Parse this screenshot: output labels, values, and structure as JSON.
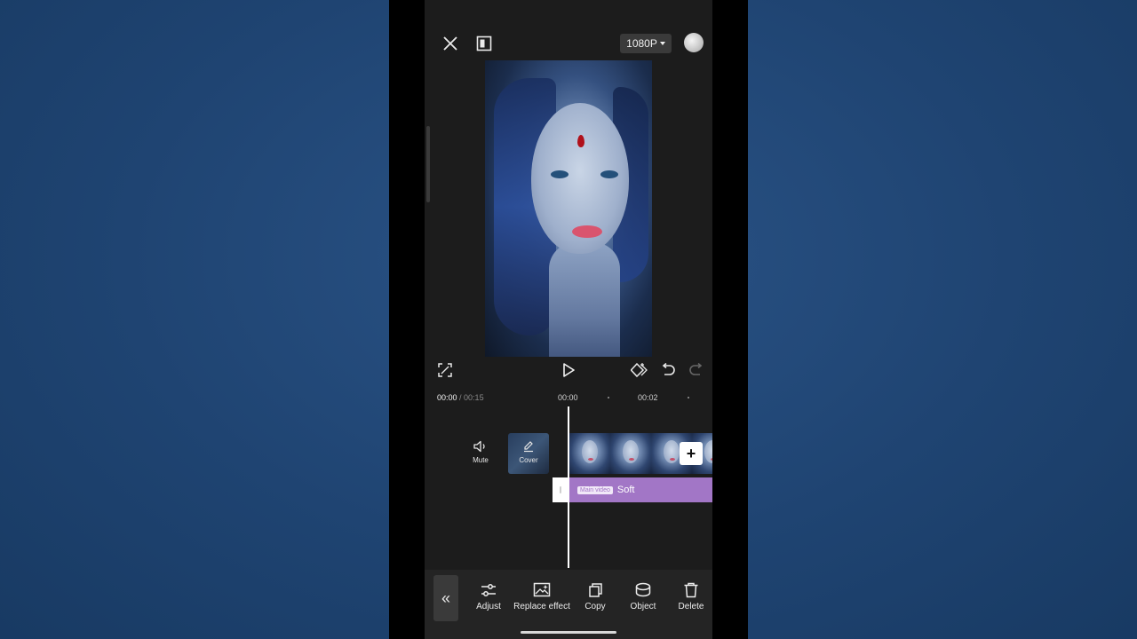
{
  "topbar": {
    "close_icon": "close-icon",
    "layout_icon": "layout-icon",
    "resolution": "1080P",
    "export_icon": "export-icon"
  },
  "preview": {
    "description_icon": "video-preview"
  },
  "controls": {
    "fullscreen_icon": "fullscreen-icon",
    "play_icon": "play-icon",
    "keyframe_icon": "keyframe-icon",
    "undo_icon": "undo-icon",
    "redo_icon": "redo-icon"
  },
  "timeline": {
    "current_time": "00:00",
    "total_time": "/ 00:15",
    "ruler": [
      "00:00",
      "00:02"
    ]
  },
  "track": {
    "mute_label": "Mute",
    "cover_label": "Cover",
    "add_icon": "plus-icon"
  },
  "effect": {
    "badge": "Main video",
    "name": "Soft",
    "color": "#a276c6"
  },
  "toolbar": {
    "items": [
      {
        "label": "Adjust",
        "icon": "adjust-icon"
      },
      {
        "label": "Replace effect",
        "icon": "replace-effect-icon"
      },
      {
        "label": "Copy",
        "icon": "copy-icon"
      },
      {
        "label": "Object",
        "icon": "object-icon"
      },
      {
        "label": "Delete",
        "icon": "delete-icon"
      }
    ]
  }
}
